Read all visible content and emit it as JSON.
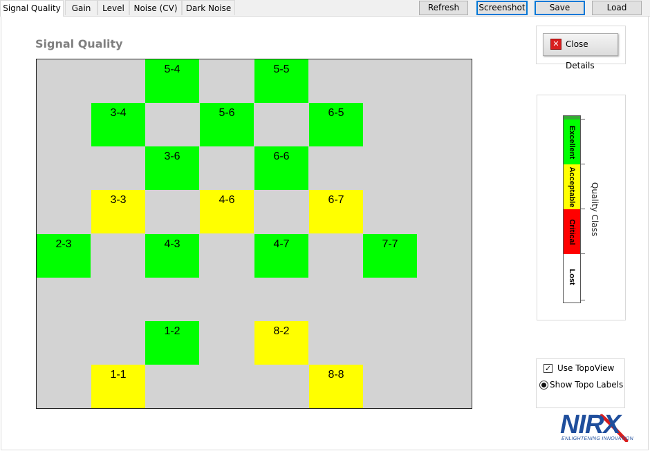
{
  "tabs": [
    {
      "label": "Signal Quality",
      "active": true
    },
    {
      "label": "Gain"
    },
    {
      "label": "Level"
    },
    {
      "label": "Noise (CV)"
    },
    {
      "label": "Dark Noise"
    }
  ],
  "toolbar": {
    "refresh_label": "Refresh",
    "screenshot_label": "Screenshot",
    "save_label": "Save",
    "load_label": "Load"
  },
  "plot": {
    "title": "Signal Quality",
    "cells": [
      {
        "label": "5-4",
        "quality": "excellent"
      },
      {
        "label": "5-5",
        "quality": "excellent"
      },
      {
        "label": "3-4",
        "quality": "excellent"
      },
      {
        "label": "5-6",
        "quality": "excellent"
      },
      {
        "label": "6-5",
        "quality": "excellent"
      },
      {
        "label": "3-6",
        "quality": "excellent"
      },
      {
        "label": "6-6",
        "quality": "excellent"
      },
      {
        "label": "3-3",
        "quality": "acceptable"
      },
      {
        "label": "4-6",
        "quality": "acceptable"
      },
      {
        "label": "6-7",
        "quality": "acceptable"
      },
      {
        "label": "2-3",
        "quality": "excellent"
      },
      {
        "label": "4-3",
        "quality": "excellent"
      },
      {
        "label": "4-7",
        "quality": "excellent"
      },
      {
        "label": "7-7",
        "quality": "excellent"
      },
      {
        "label": "1-2",
        "quality": "excellent"
      },
      {
        "label": "8-2",
        "quality": "acceptable"
      },
      {
        "label": "1-1",
        "quality": "acceptable"
      },
      {
        "label": "8-8",
        "quality": "acceptable"
      }
    ]
  },
  "details": {
    "close_label": "Close Details",
    "close_icon": "close-icon"
  },
  "legend": {
    "axis_label": "Quality Class",
    "classes": [
      {
        "label": "Excellent",
        "color": "#00ff00"
      },
      {
        "label": "Acceptable",
        "color": "#ffff00"
      },
      {
        "label": "Critical",
        "color": "#ff0000"
      },
      {
        "label": "Lost",
        "color": "#ffffff"
      }
    ]
  },
  "options": {
    "use_topoview_label": "Use TopoView",
    "use_topoview_checked": true,
    "show_topo_labels_label": "Show Topo Labels",
    "show_topo_labels_selected": true
  },
  "logo": {
    "text": "NIRX",
    "tagline": "ENLIGHTENING INNOVATION"
  },
  "colors": {
    "excellent": "#00ff00",
    "acceptable": "#ffff00",
    "critical": "#ff0000",
    "lost": "#ffffff",
    "empty": "#d3d3d3",
    "brand_blue": "#1f4e9c",
    "brand_red": "#d81e1e"
  }
}
